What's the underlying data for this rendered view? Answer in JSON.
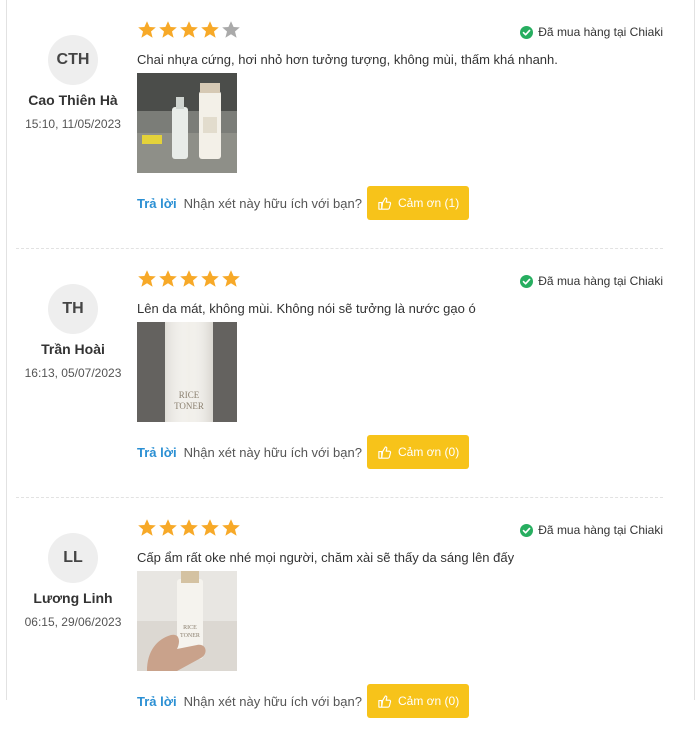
{
  "colors": {
    "star_filled": "#f7a928",
    "star_empty": "#aaaaaa",
    "verified": "#27ae60",
    "accent_button": "#f7c31a",
    "link": "#2a8fd3"
  },
  "reviews": [
    {
      "initials": "CTH",
      "name": "Cao Thiên Hà",
      "time": "15:10, 11/05/2023",
      "rating": 4,
      "verified_text": "Đã mua hàng tại Chiaki",
      "comment": "Chai nhựa cứng, hơi nhỏ hơn tưởng tượng, không mùi, thấm khá nhanh.",
      "reply_label": "Trả lời",
      "helpful_question": "Nhận xét này hữu ích với bạn?",
      "thanks_label": "Cảm ơn (1)"
    },
    {
      "initials": "TH",
      "name": "Trần Hoài",
      "time": "16:13, 05/07/2023",
      "rating": 5,
      "verified_text": "Đã mua hàng tại Chiaki",
      "comment": "Lên da mát, không mùi. Không nói sẽ tưởng là nước gạo ó",
      "reply_label": "Trả lời",
      "helpful_question": "Nhận xét này hữu ích với bạn?",
      "thanks_label": "Cảm ơn (0)"
    },
    {
      "initials": "LL",
      "name": "Lương Linh",
      "time": "06:15, 29/06/2023",
      "rating": 5,
      "verified_text": "Đã mua hàng tại Chiaki",
      "comment": "Cấp ẩm rất oke nhé mọi người, chăm xài sẽ thấy da sáng lên đấy",
      "reply_label": "Trả lời",
      "helpful_question": "Nhận xét này hữu ích với bạn?",
      "thanks_label": "Cảm ơn (0)"
    }
  ]
}
